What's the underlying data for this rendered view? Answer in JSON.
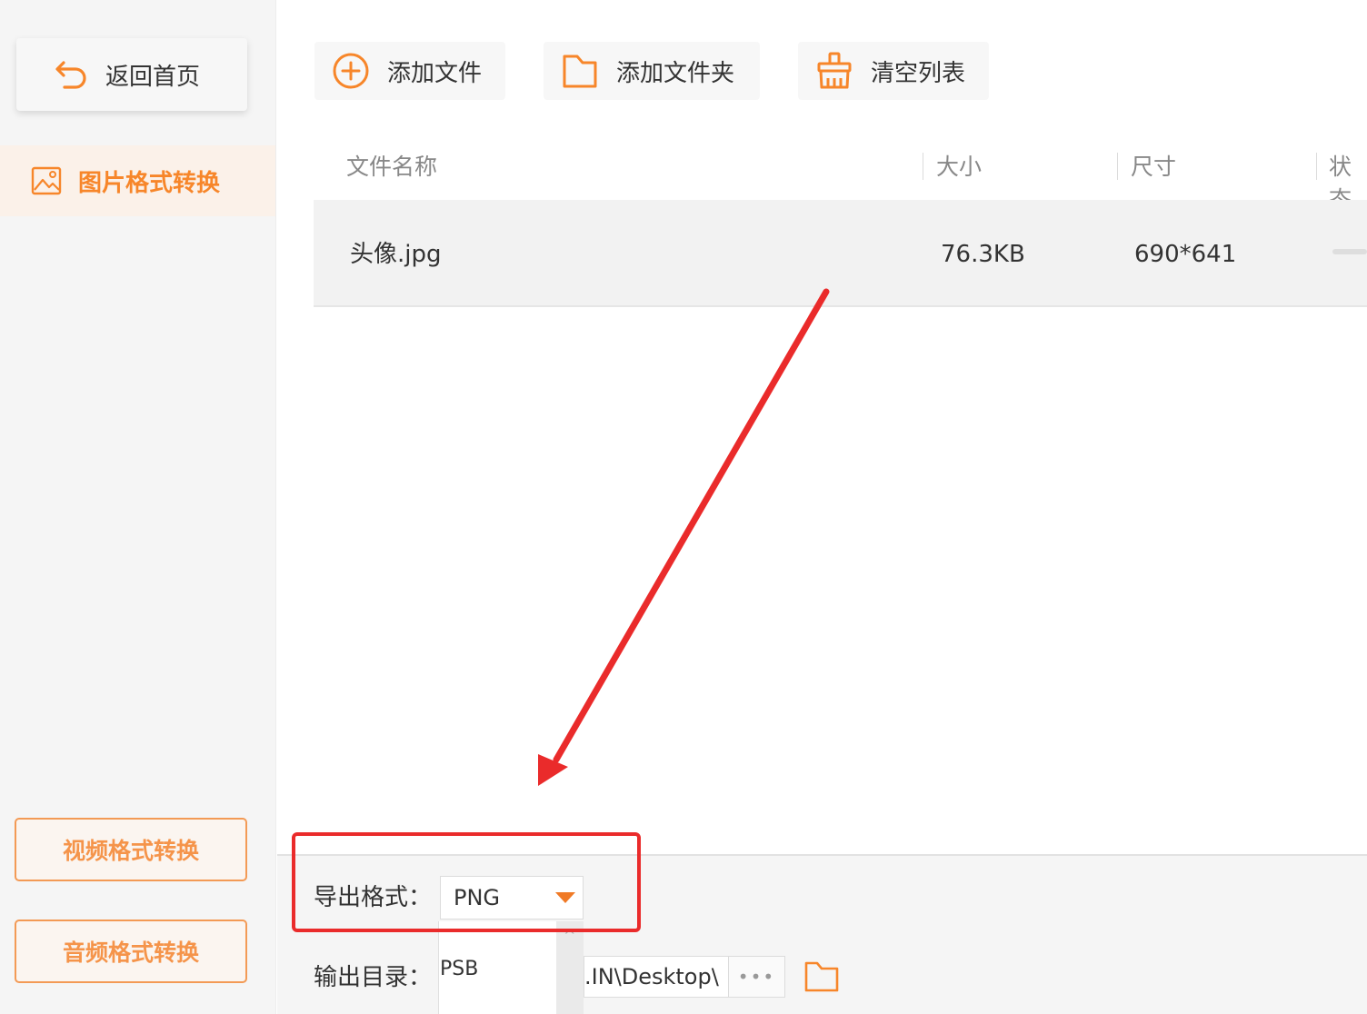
{
  "sidebar": {
    "back_label": "返回首页",
    "active_item": "图片格式转换",
    "video_btn": "视频格式转换",
    "audio_btn": "音频格式转换"
  },
  "toolbar": {
    "add_file": "添加文件",
    "add_folder": "添加文件夹",
    "clear_list": "清空列表"
  },
  "table": {
    "headers": [
      "文件名称",
      "大小",
      "尺寸",
      "状态"
    ],
    "rows": [
      {
        "name": "头像.jpg",
        "size": "76.3KB",
        "dimensions": "690*641"
      }
    ]
  },
  "bottom": {
    "format_label": "导出格式：",
    "format_value": "PNG",
    "dropdown_option": "PSB",
    "output_label": "输出目录：",
    "output_path": ".IN\\Desktop\\",
    "more_label": "•••"
  },
  "colors": {
    "accent": "#f7862a",
    "annotation": "#ea2b2b"
  }
}
